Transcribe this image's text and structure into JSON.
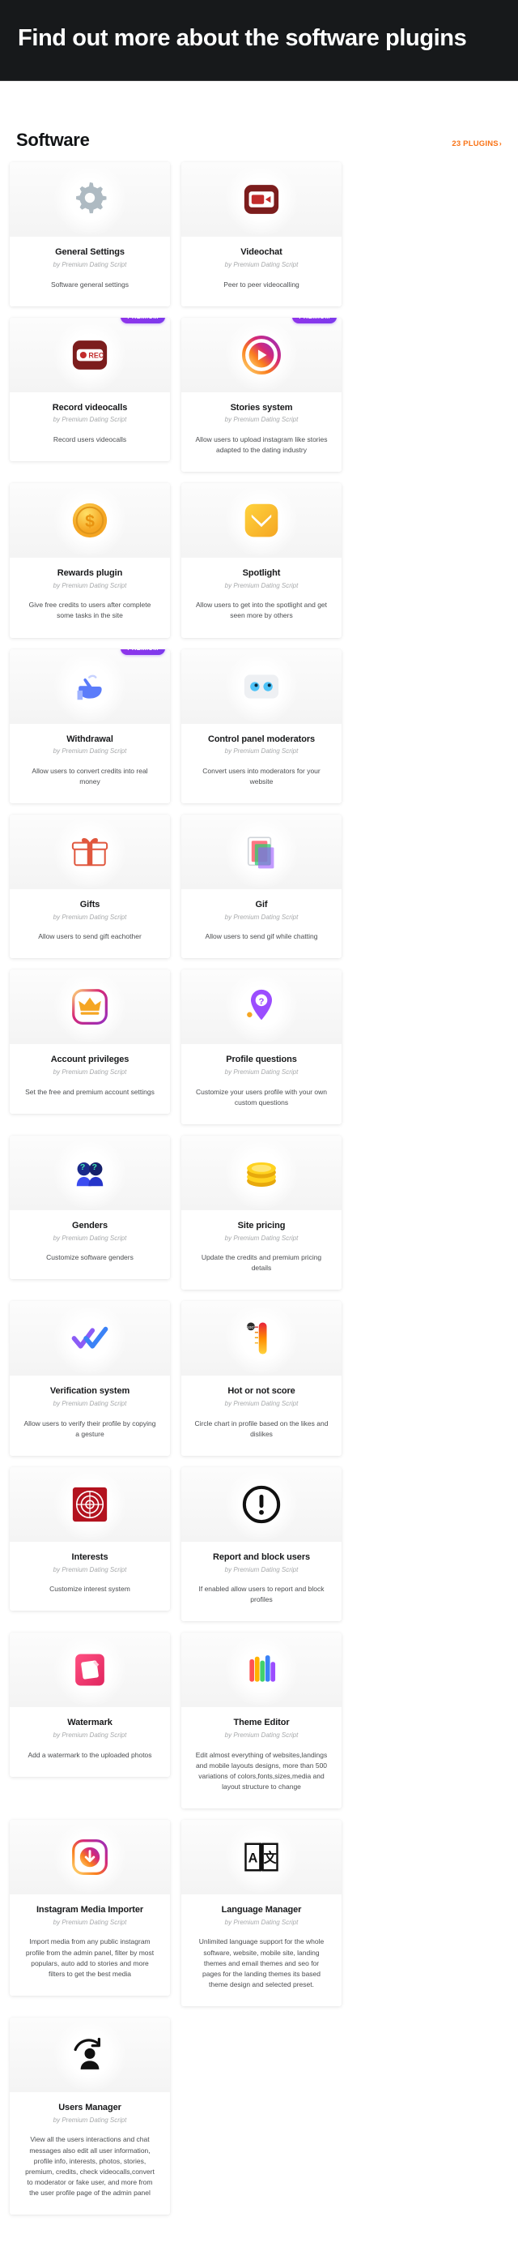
{
  "hero": {
    "title": "Find out more about the software plugins"
  },
  "section": {
    "title": "Software",
    "link_label": "23 PLUGINS",
    "link_chevron": "›",
    "accent_color": "#f97316"
  },
  "badge_label": "PREMIUM",
  "author_prefix": "by",
  "author_name": "Premium Dating Script",
  "plugins": [
    {
      "title": "General Settings",
      "author": "by Premium Dating Script",
      "desc": "Software general settings",
      "icon": "gear-icon",
      "premium": false
    },
    {
      "title": "Videochat",
      "author": "by Premium Dating Script",
      "desc": "Peer to peer videocalling",
      "icon": "videocamera-icon",
      "premium": false
    },
    {
      "title": "Record videocalls",
      "author": "by Premium Dating Script",
      "desc": "Record users videocalls",
      "icon": "record-icon",
      "premium": true
    },
    {
      "title": "Stories system",
      "author": "by Premium Dating Script",
      "desc": "Allow users to upload instagram like stories adapted to the dating industry",
      "icon": "stories-icon",
      "premium": true
    },
    {
      "title": "Rewards plugin",
      "author": "by Premium Dating Script",
      "desc": "Give free credits to users after complete some tasks in the site",
      "icon": "coin-icon",
      "premium": false
    },
    {
      "title": "Spotlight",
      "author": "by Premium Dating Script",
      "desc": "Allow users to get into the spotlight and get seen more by others",
      "icon": "spotlight-icon",
      "premium": false
    },
    {
      "title": "Withdrawal",
      "author": "by Premium Dating Script",
      "desc": "Allow users to convert credits into real money",
      "icon": "withdrawal-icon",
      "premium": true
    },
    {
      "title": "Control panel moderators",
      "author": "by Premium Dating Script",
      "desc": "Convert users into moderators for your website",
      "icon": "moderators-icon",
      "premium": false
    },
    {
      "title": "Gifts",
      "author": "by Premium Dating Script",
      "desc": "Allow users to send gift eachother",
      "icon": "gift-icon",
      "premium": false
    },
    {
      "title": "Gif",
      "author": "by Premium Dating Script",
      "desc": "Allow users to send gif while chatting",
      "icon": "gif-icon",
      "premium": false
    },
    {
      "title": "Account privileges",
      "author": "by Premium Dating Script",
      "desc": "Set the free and premium account settings",
      "icon": "crown-icon",
      "premium": false
    },
    {
      "title": "Profile questions",
      "author": "by Premium Dating Script",
      "desc": "Customize your users profile with your own custom questions",
      "icon": "question-pin-icon",
      "premium": false
    },
    {
      "title": "Genders",
      "author": "by Premium Dating Script",
      "desc": "Customize software genders",
      "icon": "genders-icon",
      "premium": false
    },
    {
      "title": "Site pricing",
      "author": "by Premium Dating Script",
      "desc": "Update the credits and premium pricing details",
      "icon": "coins-stack-icon",
      "premium": false
    },
    {
      "title": "Verification system",
      "author": "by Premium Dating Script",
      "desc": "Allow users to verify their profile by copying a gesture",
      "icon": "double-check-icon",
      "premium": false
    },
    {
      "title": "Hot or not score",
      "author": "by Premium Dating Script",
      "desc": "Circle chart in profile based on the likes and dislikes",
      "icon": "thermometer-icon",
      "premium": false
    },
    {
      "title": "Interests",
      "author": "by Premium Dating Script",
      "desc": "Customize interest system",
      "icon": "target-icon",
      "premium": false
    },
    {
      "title": "Report and block users",
      "author": "by Premium Dating Script",
      "desc": "If enabled allow users to report and block profiles",
      "icon": "exclamation-circle-icon",
      "premium": false
    },
    {
      "title": "Watermark",
      "author": "by Premium Dating Script",
      "desc": "Add a watermark to the uploaded photos",
      "icon": "watermark-icon",
      "premium": false
    },
    {
      "title": "Theme Editor",
      "author": "by Premium Dating Script",
      "desc": "Edit almost everything of websites,landings and mobile layouts designs, more than 500 variations of colors,fonts,sizes,media and layout structure to change",
      "icon": "palette-icon",
      "premium": false
    },
    {
      "title": "Instagram Media Importer",
      "author": "by Premium Dating Script",
      "desc": "Import media from any public instagram profile from the admin panel, filter by most populars, auto add to stories and more filters to get the best media",
      "icon": "instagram-import-icon",
      "premium": false
    },
    {
      "title": "Language Manager",
      "author": "by Premium Dating Script",
      "desc": "Unlimited language support for the whole software, website, mobile site, landing themes and email themes and seo for pages for the landing themes its based theme design and selected preset.",
      "icon": "language-icon",
      "premium": false
    },
    {
      "title": "Users Manager",
      "author": "by Premium Dating Script",
      "desc": "View all the users interactions and chat messages also edit all user information, profile info, interests, photos, stories, premium, credits, check videocalls,convert to moderator or fake user, and more from the user profile page of the admin panel",
      "icon": "users-manager-icon",
      "premium": false
    }
  ]
}
